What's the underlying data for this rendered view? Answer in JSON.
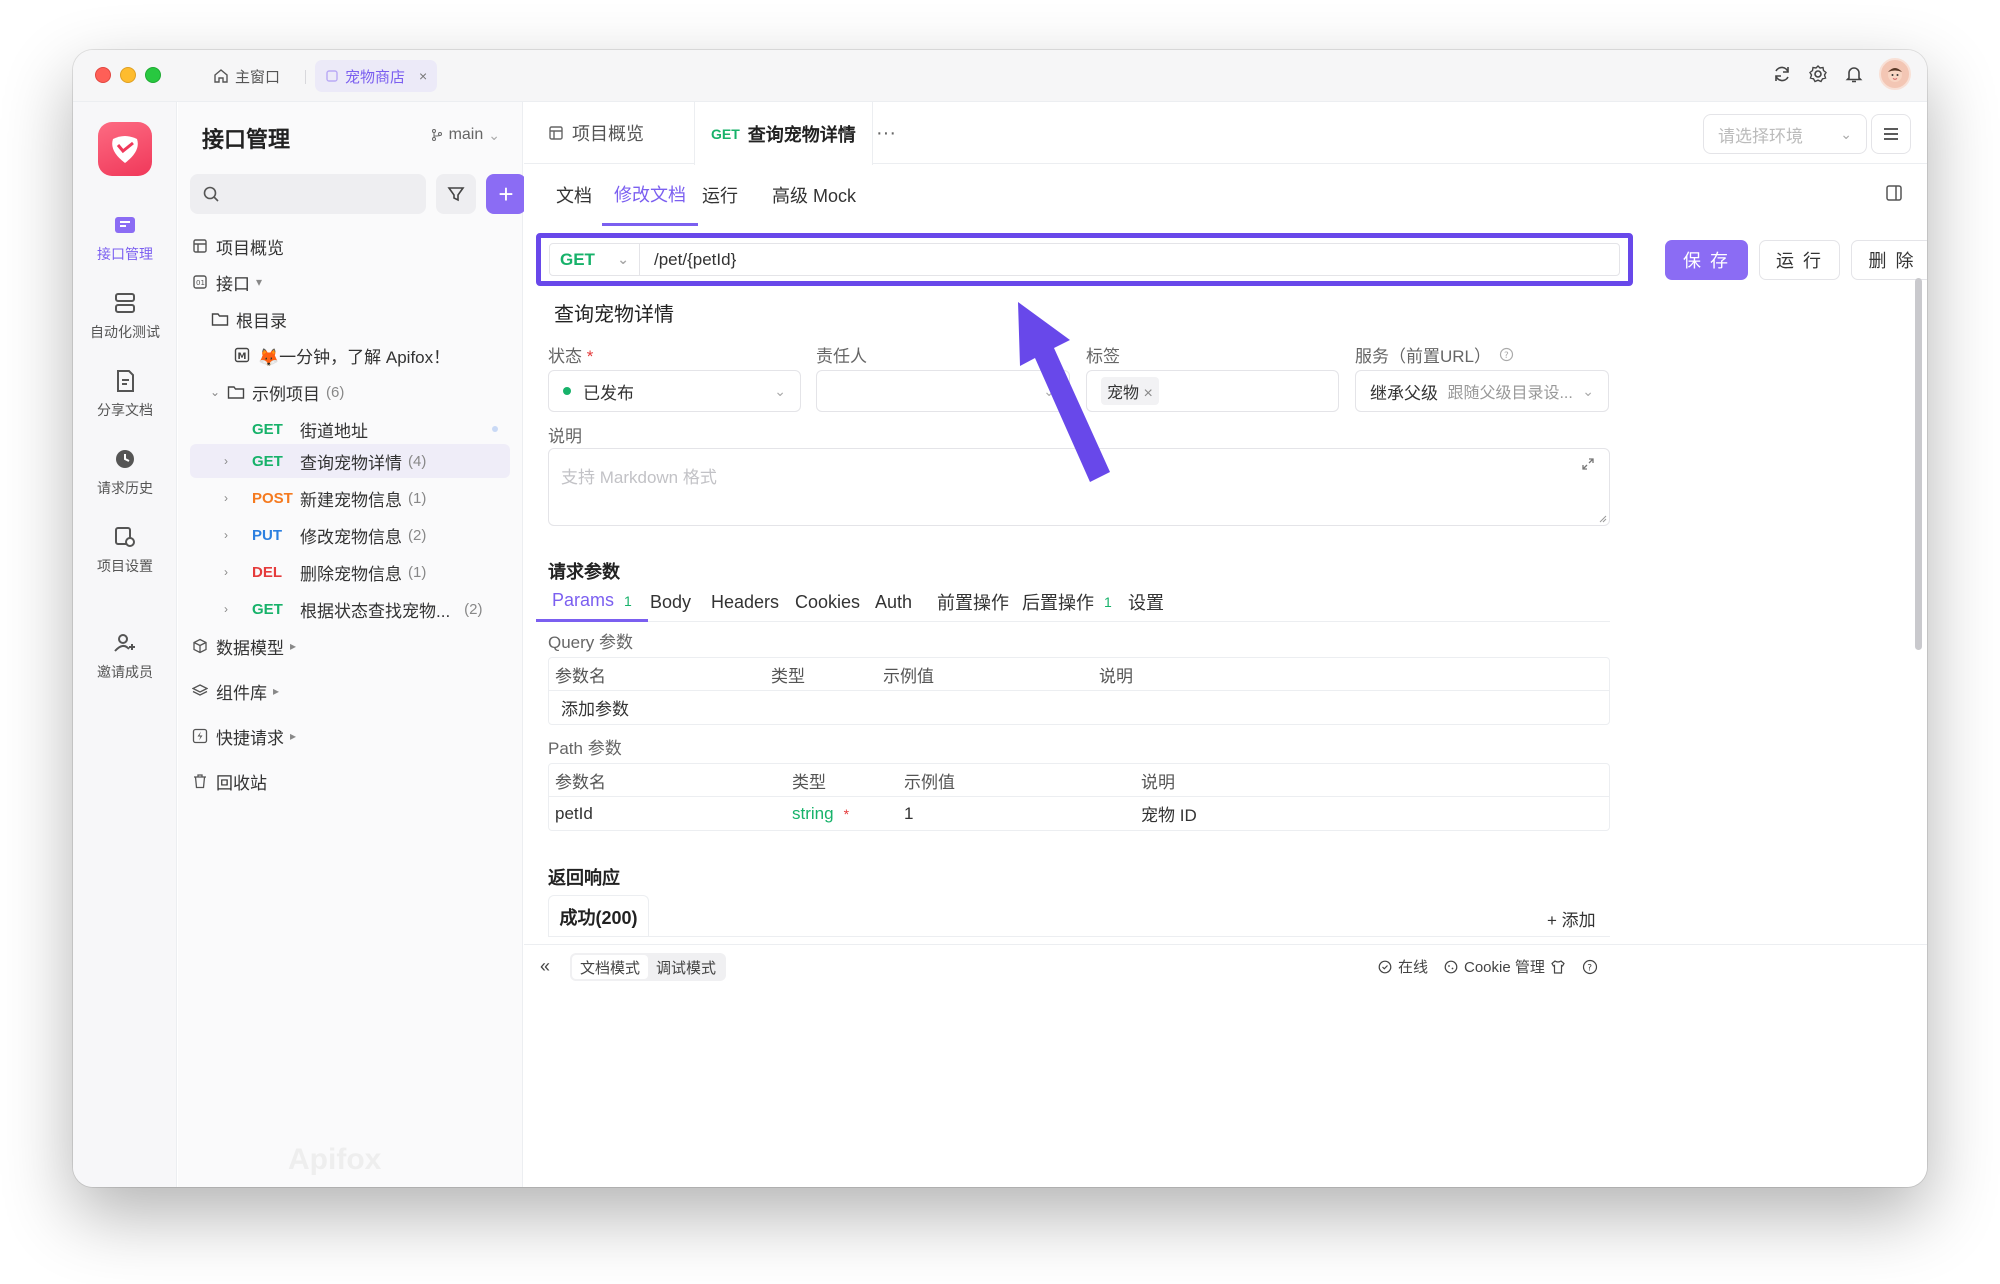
{
  "window": {
    "tabs": [
      {
        "label": "主窗口"
      },
      {
        "label": "宠物商店"
      }
    ]
  },
  "rail": {
    "items": [
      {
        "label": "接口管理",
        "active": true
      },
      {
        "label": "自动化测试"
      },
      {
        "label": "分享文档"
      },
      {
        "label": "请求历史"
      },
      {
        "label": "项目设置"
      },
      {
        "label": "邀请成员"
      }
    ]
  },
  "sidebar": {
    "title": "接口管理",
    "branch": "main",
    "tree": [
      {
        "label": "项目概览"
      },
      {
        "label": "接口"
      },
      {
        "label": "根目录"
      },
      {
        "label": "🦊一分钟，了解 Apifox！"
      },
      {
        "label": "示例项目",
        "count": "(6)"
      },
      {
        "method": "GET",
        "label": "街道地址"
      },
      {
        "method": "GET",
        "label": "查询宠物详情",
        "count": "(4)"
      },
      {
        "method": "POST",
        "label": "新建宠物信息",
        "count": "(1)"
      },
      {
        "method": "PUT",
        "label": "修改宠物信息",
        "count": "(2)"
      },
      {
        "method": "DEL",
        "label": "删除宠物信息",
        "count": "(1)"
      },
      {
        "method": "GET",
        "label": "根据状态查找宠物...",
        "count": "(2)"
      },
      {
        "label": "数据模型"
      },
      {
        "label": "组件库"
      },
      {
        "label": "快捷请求"
      },
      {
        "label": "回收站"
      }
    ],
    "watermark": "Apifox"
  },
  "main": {
    "tabs": [
      {
        "label": "项目概览"
      },
      {
        "method": "GET",
        "label": "查询宠物详情"
      }
    ],
    "env_placeholder": "请选择环境",
    "subtabs": [
      "文档",
      "修改文档",
      "运行",
      "高级 Mock"
    ],
    "request": {
      "method": "GET",
      "path": "/pet/{petId}"
    },
    "buttons": {
      "save": "保 存",
      "run": "运 行",
      "delete": "删 除"
    },
    "api_name": "查询宠物详情",
    "fields": {
      "status_label": "状态",
      "status_value": "已发布",
      "owner_label": "责任人",
      "tags_label": "标签",
      "tag_value": "宠物",
      "service_label": "服务（前置URL）",
      "service_value": "继承父级",
      "service_hint": "跟随父级目录设..."
    },
    "description": {
      "label": "说明",
      "placeholder": "支持 Markdown 格式"
    },
    "params": {
      "title": "请求参数",
      "tabs": [
        {
          "label": "Params",
          "badge": "1"
        },
        {
          "label": "Body"
        },
        {
          "label": "Headers"
        },
        {
          "label": "Cookies"
        },
        {
          "label": "Auth"
        },
        {
          "label": "前置操作"
        },
        {
          "label": "后置操作",
          "badge": "1"
        },
        {
          "label": "设置"
        }
      ],
      "query_label": "Query 参数",
      "path_label": "Path 参数",
      "columns": [
        "参数名",
        "类型",
        "示例值",
        "说明"
      ],
      "add_placeholder": "添加参数",
      "path_row": {
        "name": "petId",
        "type": "string",
        "example": "1",
        "desc": "宠物 ID"
      }
    },
    "response": {
      "title": "返回响应",
      "tab": "成功(200)",
      "add": "添加"
    }
  },
  "statusbar": {
    "modes": [
      "文档模式",
      "调试模式"
    ],
    "online": "在线",
    "cookie": "Cookie 管理"
  },
  "colors": {
    "accent": "#7b5ff0",
    "annotation": "#6848ea",
    "get": "#17b26a",
    "post": "#f57a1f",
    "put": "#2b7fe0",
    "del": "#e53b3b"
  }
}
